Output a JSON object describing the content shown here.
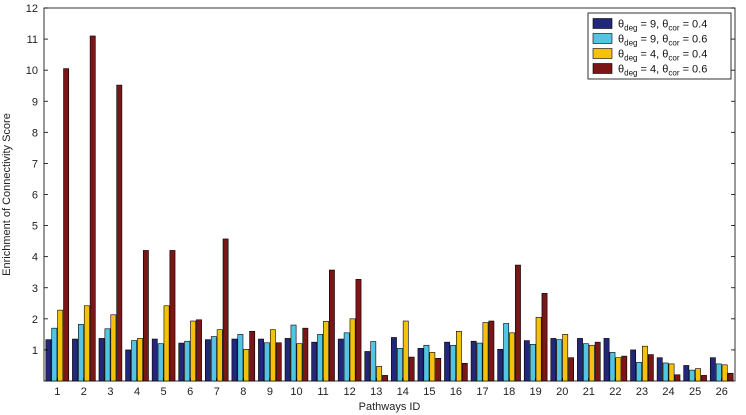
{
  "chart_data": {
    "type": "bar",
    "title": "",
    "xlabel": "Pathways ID",
    "ylabel": "Enrichment of Connectivity Score",
    "ylim": [
      0,
      12
    ],
    "yticks": [
      1,
      2,
      3,
      4,
      5,
      6,
      7,
      8,
      9,
      10,
      11,
      12
    ],
    "grid": false,
    "legend_position": "top-right",
    "categories": [
      "1",
      "2",
      "3",
      "4",
      "5",
      "6",
      "7",
      "8",
      "9",
      "10",
      "11",
      "12",
      "13",
      "14",
      "15",
      "16",
      "17",
      "18",
      "19",
      "20",
      "21",
      "22",
      "23",
      "24",
      "25",
      "26"
    ],
    "series": [
      {
        "name_parts": {
          "sym": "θ",
          "sub1": "deg",
          "mid": " = 9, ",
          "sub2": "cor",
          "end": " = 0.4"
        },
        "color": "#23277a",
        "values": [
          1.33,
          1.35,
          1.37,
          1.0,
          1.35,
          1.22,
          1.33,
          1.35,
          1.35,
          1.37,
          1.25,
          1.35,
          0.95,
          1.4,
          1.05,
          1.25,
          1.28,
          1.02,
          1.3,
          1.37,
          1.37,
          1.37,
          1.0,
          0.75,
          0.5,
          0.75
        ]
      },
      {
        "name_parts": {
          "sym": "θ",
          "sub1": "deg",
          "mid": " = 9, ",
          "sub2": "cor",
          "end": " = 0.6"
        },
        "color": "#52c4e4",
        "values": [
          1.7,
          1.82,
          1.68,
          1.3,
          1.2,
          1.28,
          1.43,
          1.5,
          1.23,
          1.8,
          1.5,
          1.55,
          1.27,
          1.05,
          1.15,
          1.15,
          1.22,
          1.85,
          1.18,
          1.33,
          1.2,
          0.92,
          0.6,
          0.58,
          0.35,
          0.55
        ]
      },
      {
        "name_parts": {
          "sym": "θ",
          "sub1": "deg",
          "mid": " = 4, ",
          "sub2": "cor",
          "end": " = 0.4"
        },
        "color": "#f4c20d",
        "values": [
          2.28,
          2.42,
          2.13,
          1.37,
          2.42,
          1.93,
          1.65,
          1.02,
          1.65,
          1.2,
          1.92,
          2.0,
          0.47,
          1.93,
          0.92,
          1.6,
          1.88,
          1.55,
          2.05,
          1.5,
          1.15,
          0.75,
          1.12,
          0.55,
          0.4,
          0.52
        ]
      },
      {
        "name_parts": {
          "sym": "θ",
          "sub1": "deg",
          "mid": " = 4, ",
          "sub2": "cor",
          "end": " = 0.6"
        },
        "color": "#7a1616",
        "values": [
          10.05,
          11.1,
          9.52,
          4.2,
          4.2,
          1.97,
          4.57,
          1.6,
          1.23,
          1.7,
          3.57,
          3.27,
          0.18,
          0.77,
          0.73,
          0.57,
          1.93,
          3.73,
          2.82,
          0.75,
          1.25,
          0.8,
          0.85,
          0.2,
          0.18,
          0.25
        ]
      }
    ]
  }
}
